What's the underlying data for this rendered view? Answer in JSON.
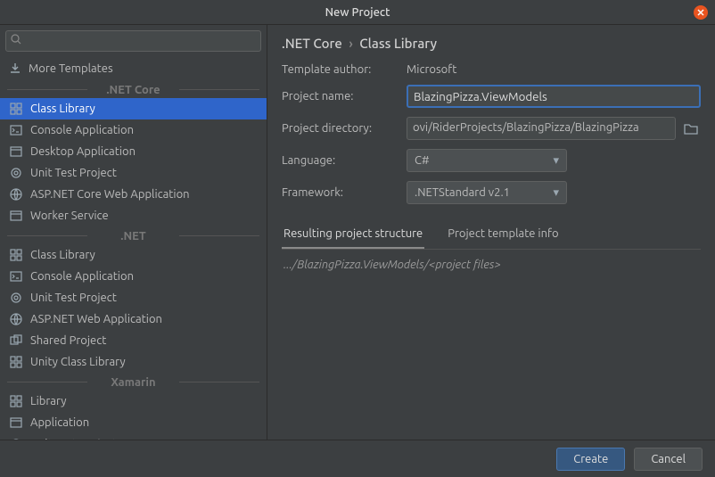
{
  "title": "New Project",
  "search_placeholder": "",
  "more_templates": "More Templates",
  "sections": [
    {
      "header": ".NET Core",
      "items": [
        {
          "id": "classlib",
          "label": "Class Library",
          "icon": "grid",
          "selected": true
        },
        {
          "id": "console",
          "label": "Console Application",
          "icon": "terminal"
        },
        {
          "id": "desktop",
          "label": "Desktop Application",
          "icon": "window"
        },
        {
          "id": "unit",
          "label": "Unit Test Project",
          "icon": "target"
        },
        {
          "id": "aspnet",
          "label": "ASP.NET Core Web Application",
          "icon": "globe"
        },
        {
          "id": "worker",
          "label": "Worker Service",
          "icon": "window"
        }
      ]
    },
    {
      "header": ".NET",
      "items": [
        {
          "id": "classlib2",
          "label": "Class Library",
          "icon": "grid"
        },
        {
          "id": "console2",
          "label": "Console Application",
          "icon": "terminal"
        },
        {
          "id": "unit2",
          "label": "Unit Test Project",
          "icon": "target"
        },
        {
          "id": "aspnet2",
          "label": "ASP.NET Web Application",
          "icon": "globe"
        },
        {
          "id": "shared",
          "label": "Shared Project",
          "icon": "share"
        },
        {
          "id": "unity",
          "label": "Unity Class Library",
          "icon": "grid"
        }
      ]
    },
    {
      "header": "Xamarin",
      "items": [
        {
          "id": "xlib",
          "label": "Library",
          "icon": "grid"
        },
        {
          "id": "xapp",
          "label": "Application",
          "icon": "window"
        },
        {
          "id": "xunit",
          "label": "Unit Test Project",
          "icon": "target"
        }
      ]
    }
  ],
  "breadcrumb": {
    "root": ".NET Core",
    "leaf": "Class Library"
  },
  "form": {
    "author_label": "Template author:",
    "author_value": "Microsoft",
    "name_label": "Project name:",
    "name_value": "BlazingPizza.ViewModels",
    "dir_label": "Project directory:",
    "dir_value": "ovi/RiderProjects/BlazingPizza/BlazingPizza",
    "lang_label": "Language:",
    "lang_value": "C#",
    "fw_label": "Framework:",
    "fw_value": ".NETStandard v2.1"
  },
  "tabs": {
    "t1": "Resulting project structure",
    "t2": "Project template info"
  },
  "result_text": ".../BlazingPizza.ViewModels/<project files>",
  "buttons": {
    "create": "Create",
    "cancel": "Cancel"
  }
}
